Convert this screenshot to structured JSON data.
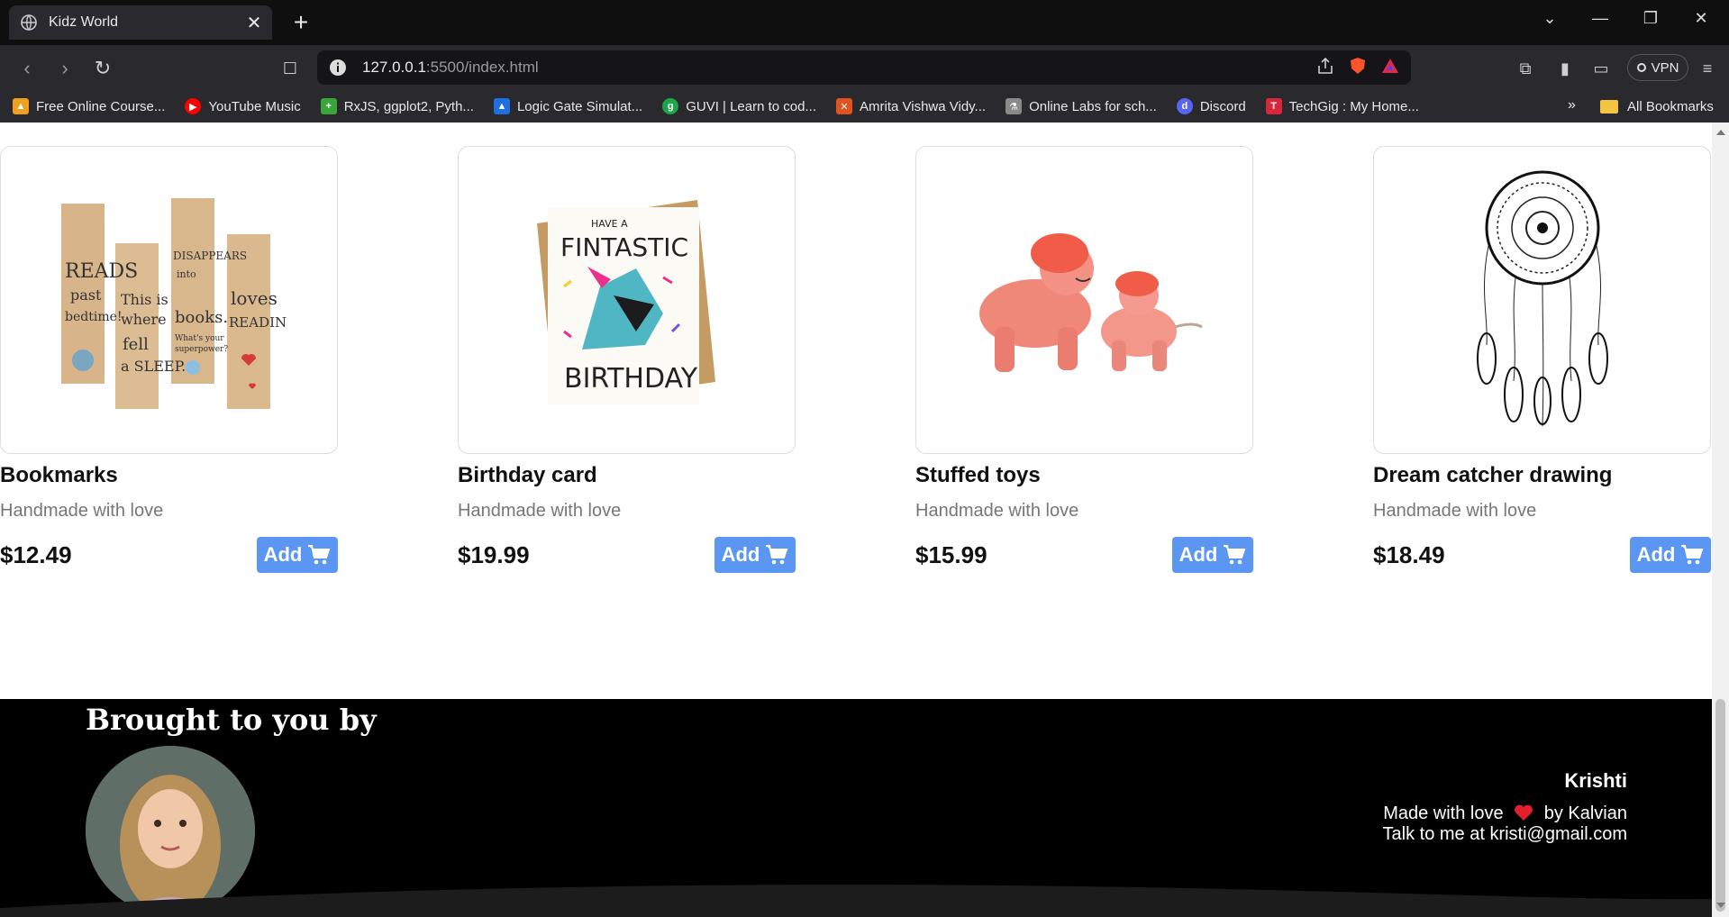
{
  "browser": {
    "tab_title": "Kidz World",
    "url_host": "127.0.0.1",
    "url_rest": ":5500/index.html",
    "vpn_label": "VPN",
    "bookmarks": [
      {
        "label": "Free Online Course...",
        "color": "#f0a020"
      },
      {
        "label": "YouTube Music",
        "color": "#ff0000"
      },
      {
        "label": "RxJS, ggplot2, Pyth...",
        "color": "#3aa53a"
      },
      {
        "label": "Logic Gate Simulat...",
        "color": "#1f6fe0"
      },
      {
        "label": "GUVI | Learn to cod...",
        "color": "#1ea54a"
      },
      {
        "label": "Amrita Vishwa Vidy...",
        "color": "#e0531f"
      },
      {
        "label": "Online Labs for sch...",
        "color": "#cccccc"
      },
      {
        "label": "Discord",
        "color": "#5865f2"
      },
      {
        "label": "TechGig : My Home...",
        "color": "#d9263a"
      }
    ],
    "more_label": "»",
    "all_bookmarks_label": "All Bookmarks"
  },
  "products": [
    {
      "name": "Bookmarks",
      "subtitle": "Handmade with love",
      "price": "$12.49",
      "button": "Add",
      "image": "bookmarks-illustration"
    },
    {
      "name": "Birthday card",
      "subtitle": "Handmade with love",
      "price": "$19.99",
      "button": "Add",
      "image": "birthday-card-illustration"
    },
    {
      "name": "Stuffed toys",
      "subtitle": "Handmade with love",
      "price": "$15.99",
      "button": "Add",
      "image": "stuffed-toys-illustration"
    },
    {
      "name": "Dream catcher drawing",
      "subtitle": "Handmade with love",
      "price": "$18.49",
      "button": "Add",
      "image": "dream-catcher-illustration"
    }
  ],
  "footer": {
    "heading": "Brought to you by",
    "name": "Krishti",
    "made_with": "Made with love",
    "by": "by Kalvian",
    "contact": "Talk to me at kristi@gmail.com",
    "heart_color": "#e0202a"
  },
  "colors": {
    "add_button": "#5b97f2",
    "footer_bg": "#000000"
  }
}
